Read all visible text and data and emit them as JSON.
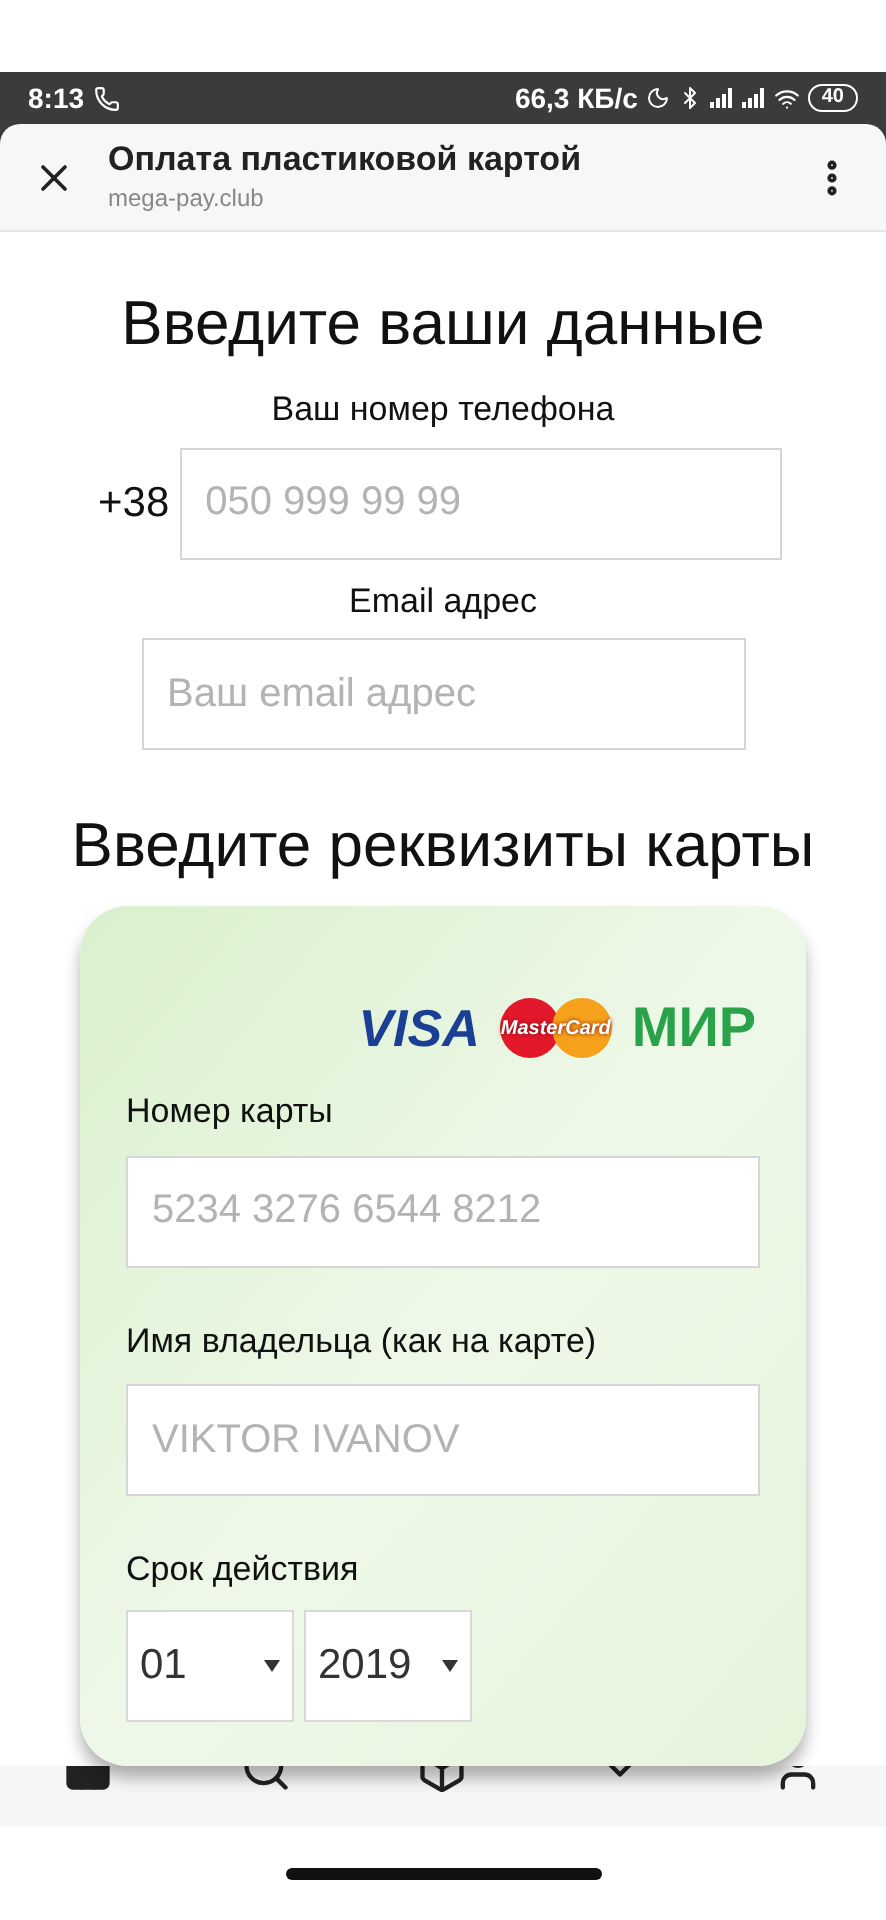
{
  "status_bar": {
    "time": "8:13",
    "speed": "66,3 КБ/с",
    "battery": "40"
  },
  "browser": {
    "title": "Оплата пластиковой картой",
    "url": "mega-pay.club"
  },
  "contact": {
    "heading": "Введите ваши данные",
    "phone_label": "Ваш номер телефона",
    "phone_prefix": "+38",
    "phone_placeholder": "050 999 99 99",
    "email_label": "Email адрес",
    "email_placeholder": "Ваш email адрес"
  },
  "card": {
    "heading": "Введите реквизиты карты",
    "brands": [
      "VISA",
      "MasterCard",
      "МИР"
    ],
    "number_label": "Номер карты",
    "number_placeholder": "5234 3276 6544 8212",
    "holder_label": "Имя владельца (как на карте)",
    "holder_placeholder": "VIKTOR IVANOV",
    "expiry_label": "Срок действия",
    "month": "01",
    "year": "2019"
  }
}
